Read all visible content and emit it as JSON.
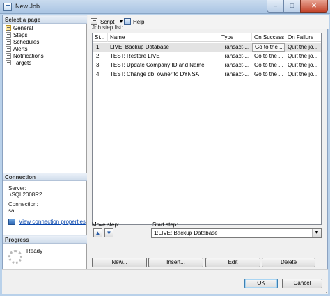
{
  "window": {
    "title": "New Job",
    "controls": {
      "minimize": "–",
      "maximize": "□",
      "close": "✕"
    }
  },
  "left_pane": {
    "select_page_header": "Select a page",
    "pages": [
      {
        "label": "General",
        "selected": true
      },
      {
        "label": "Steps",
        "selected": false
      },
      {
        "label": "Schedules",
        "selected": false
      },
      {
        "label": "Alerts",
        "selected": false
      },
      {
        "label": "Notifications",
        "selected": false
      },
      {
        "label": "Targets",
        "selected": false
      }
    ],
    "connection_header": "Connection",
    "server_label": "Server:",
    "server_value": ".\\SQL2008R2",
    "connection_label": "Connection:",
    "connection_value": "sa",
    "view_connection_link": "View connection properties",
    "progress_header": "Progress",
    "progress_status": "Ready"
  },
  "toolbar": {
    "script_label": "Script",
    "help_label": "Help"
  },
  "steps": {
    "list_label": "Job step list:",
    "columns": [
      "St...",
      "Name",
      "Type",
      "On Success",
      "On Failure"
    ],
    "rows": [
      {
        "step": "1",
        "name": "LIVE: Backup Database",
        "type": "Transact-...",
        "on_success": "Go to the ...",
        "on_failure": "Quit the jo..."
      },
      {
        "step": "2",
        "name": "TEST: Restore LIVE",
        "type": "Transact-...",
        "on_success": "Go to the ...",
        "on_failure": "Quit the jo..."
      },
      {
        "step": "3",
        "name": "TEST: Update Company ID and Name",
        "type": "Transact-...",
        "on_success": "Go to the ...",
        "on_failure": "Quit the jo..."
      },
      {
        "step": "4",
        "name": "TEST: Change db_owner to DYNSA",
        "type": "Transact-...",
        "on_success": "Go to the ...",
        "on_failure": "Quit the jo..."
      }
    ],
    "selected_row": 0,
    "move_step_label": "Move step:",
    "start_step_label": "Start step:",
    "start_step_value": "1:LIVE: Backup Database",
    "buttons": {
      "new": "New...",
      "insert": "Insert...",
      "edit": "Edit",
      "delete": "Delete"
    }
  },
  "dialog_buttons": {
    "ok": "OK",
    "cancel": "Cancel"
  }
}
